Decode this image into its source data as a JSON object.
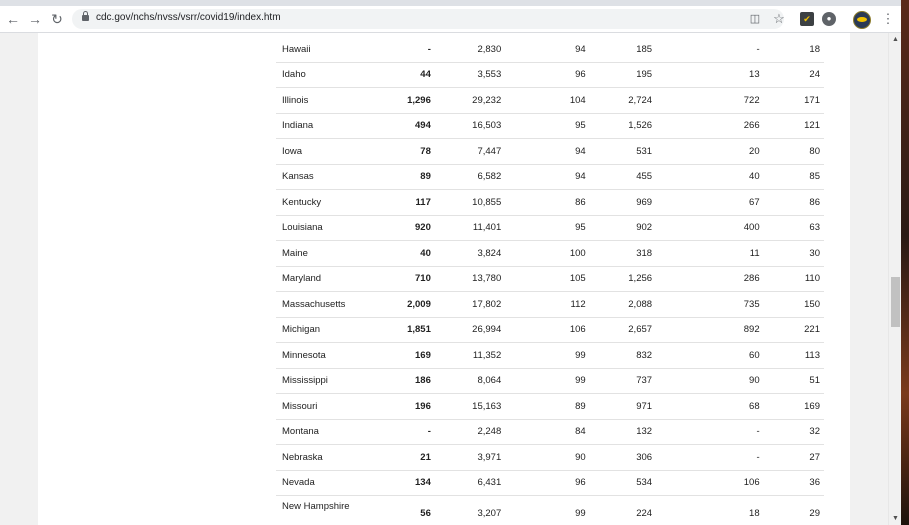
{
  "browser": {
    "url": "cdc.gov/nchs/nvss/vsrr/covid19/index.htm",
    "icons": {
      "back": "back-arrow-icon",
      "forward": "forward-arrow-icon",
      "reload": "reload-icon",
      "lock": "lock-icon",
      "translate": "translate-icon",
      "bookmark": "star-icon",
      "extension1": "shield-extension-icon",
      "extension2": "circle-extension-icon",
      "profile": "profile-avatar",
      "menu": "kebab-menu-icon"
    }
  },
  "table": {
    "rows": [
      {
        "state": "Hawaii",
        "c1": "-",
        "c2": "2,830",
        "c3": "94",
        "c4": "185",
        "c5": "-",
        "c6": "18"
      },
      {
        "state": "Idaho",
        "c1": "44",
        "c2": "3,553",
        "c3": "96",
        "c4": "195",
        "c5": "13",
        "c6": "24"
      },
      {
        "state": "Illinois",
        "c1": "1,296",
        "c2": "29,232",
        "c3": "104",
        "c4": "2,724",
        "c5": "722",
        "c6": "171"
      },
      {
        "state": "Indiana",
        "c1": "494",
        "c2": "16,503",
        "c3": "95",
        "c4": "1,526",
        "c5": "266",
        "c6": "121"
      },
      {
        "state": "Iowa",
        "c1": "78",
        "c2": "7,447",
        "c3": "94",
        "c4": "531",
        "c5": "20",
        "c6": "80"
      },
      {
        "state": "Kansas",
        "c1": "89",
        "c2": "6,582",
        "c3": "94",
        "c4": "455",
        "c5": "40",
        "c6": "85"
      },
      {
        "state": "Kentucky",
        "c1": "117",
        "c2": "10,855",
        "c3": "86",
        "c4": "969",
        "c5": "67",
        "c6": "86"
      },
      {
        "state": "Louisiana",
        "c1": "920",
        "c2": "11,401",
        "c3": "95",
        "c4": "902",
        "c5": "400",
        "c6": "63"
      },
      {
        "state": "Maine",
        "c1": "40",
        "c2": "3,824",
        "c3": "100",
        "c4": "318",
        "c5": "11",
        "c6": "30"
      },
      {
        "state": "Maryland",
        "c1": "710",
        "c2": "13,780",
        "c3": "105",
        "c4": "1,256",
        "c5": "286",
        "c6": "110"
      },
      {
        "state": "Massachusetts",
        "c1": "2,009",
        "c2": "17,802",
        "c3": "112",
        "c4": "2,088",
        "c5": "735",
        "c6": "150"
      },
      {
        "state": "Michigan",
        "c1": "1,851",
        "c2": "26,994",
        "c3": "106",
        "c4": "2,657",
        "c5": "892",
        "c6": "221"
      },
      {
        "state": "Minnesota",
        "c1": "169",
        "c2": "11,352",
        "c3": "99",
        "c4": "832",
        "c5": "60",
        "c6": "113"
      },
      {
        "state": "Mississippi",
        "c1": "186",
        "c2": "8,064",
        "c3": "99",
        "c4": "737",
        "c5": "90",
        "c6": "51"
      },
      {
        "state": "Missouri",
        "c1": "196",
        "c2": "15,163",
        "c3": "89",
        "c4": "971",
        "c5": "68",
        "c6": "169"
      },
      {
        "state": "Montana",
        "c1": "-",
        "c2": "2,248",
        "c3": "84",
        "c4": "132",
        "c5": "-",
        "c6": "32"
      },
      {
        "state": "Nebraska",
        "c1": "21",
        "c2": "3,971",
        "c3": "90",
        "c4": "306",
        "c5": "-",
        "c6": "27"
      },
      {
        "state": "Nevada",
        "c1": "134",
        "c2": "6,431",
        "c3": "96",
        "c4": "534",
        "c5": "106",
        "c6": "36"
      },
      {
        "state": "New Hampshire",
        "c1": "56",
        "c2": "3,207",
        "c3": "99",
        "c4": "224",
        "c5": "18",
        "c6": "29"
      }
    ]
  }
}
